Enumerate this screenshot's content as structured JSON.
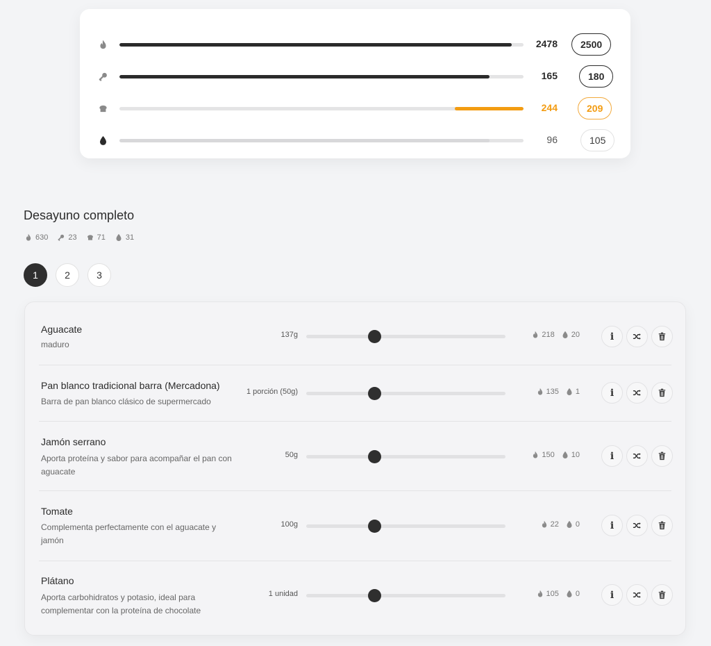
{
  "colors": {
    "accent": "#2b2b2b",
    "warning": "#f39c12",
    "track": "#e4e4e5"
  },
  "macros": [
    {
      "icon": "flame-icon",
      "current": "2478",
      "goal": "2500",
      "progress": 0.97,
      "state": "strong"
    },
    {
      "icon": "drumstick-icon",
      "current": "165",
      "goal": "180",
      "progress": 0.915,
      "state": "strong"
    },
    {
      "icon": "bread-icon",
      "current": "244",
      "goal": "209",
      "progress": 1.0,
      "over_from": 0.83,
      "state": "warn"
    },
    {
      "icon": "droplet-icon",
      "current": "96",
      "goal": "105",
      "progress": 0.915,
      "state": "normal"
    }
  ],
  "meal": {
    "title": "Desayuno completo",
    "summary": {
      "kcal": "630",
      "protein": "23",
      "carbs": "71",
      "fat": "31"
    },
    "options": [
      "1",
      "2",
      "3"
    ],
    "active_option": "1",
    "foods": [
      {
        "name": "Aguacate",
        "desc": "maduro",
        "qty": "137g",
        "slider": 0.34,
        "kcal": "218",
        "fat": "20"
      },
      {
        "name": "Pan blanco tradicional barra (Mercadona)",
        "desc": "Barra de pan blanco clásico de supermercado",
        "qty": "1 porción (50g)",
        "slider": 0.34,
        "kcal": "135",
        "fat": "1"
      },
      {
        "name": "Jamón serrano",
        "desc": "Aporta proteína y sabor para acompañar el pan con aguacate",
        "qty": "50g",
        "slider": 0.34,
        "kcal": "150",
        "fat": "10"
      },
      {
        "name": "Tomate",
        "desc": "Complementa perfectamente con el aguacate y jamón",
        "qty": "100g",
        "slider": 0.34,
        "kcal": "22",
        "fat": "0"
      },
      {
        "name": "Plátano",
        "desc": "Aporta carbohidratos y potasio, ideal para complementar con la proteína de chocolate",
        "qty": "1 unidad",
        "slider": 0.34,
        "kcal": "105",
        "fat": "0"
      }
    ]
  }
}
